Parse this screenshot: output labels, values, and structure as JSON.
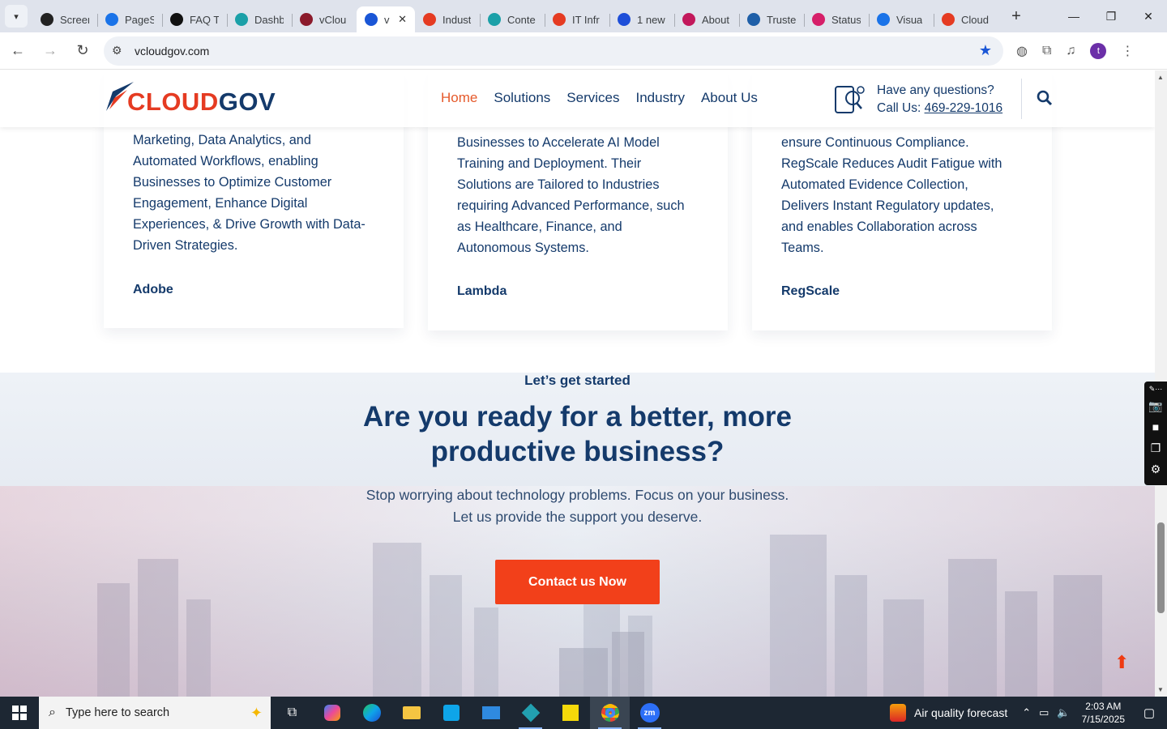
{
  "browser": {
    "tabs": [
      {
        "title": "Screen",
        "favicon_color": "#222222",
        "active": false
      },
      {
        "title": "PageS",
        "favicon_color": "#1a73e8",
        "active": false
      },
      {
        "title": "FAQ T",
        "favicon_color": "#111111",
        "active": false
      },
      {
        "title": "Dashb",
        "favicon_color": "#1ba0a8",
        "active": false
      },
      {
        "title": "vClou",
        "favicon_color": "#8b1a2b",
        "active": false
      },
      {
        "title": "vC",
        "favicon_color": "#1a56d6",
        "active": true
      },
      {
        "title": "Indust",
        "favicon_color": "#e53b22",
        "active": false
      },
      {
        "title": "Conte",
        "favicon_color": "#1ba0a8",
        "active": false
      },
      {
        "title": "IT Infr",
        "favicon_color": "#e53b22",
        "active": false
      },
      {
        "title": "1 new",
        "favicon_color": "#1d4ed8",
        "active": false
      },
      {
        "title": "About",
        "favicon_color": "#c2185b",
        "active": false
      },
      {
        "title": "Truste",
        "favicon_color": "#1f5fa8",
        "active": false
      },
      {
        "title": "Status",
        "favicon_color": "#d61f69",
        "active": false
      },
      {
        "title": "Visua",
        "favicon_color": "#1a73e8",
        "active": false
      },
      {
        "title": "Cloud",
        "favicon_color": "#e53b22",
        "active": false
      }
    ],
    "url": "vcloudgov.com"
  },
  "site": {
    "logo": {
      "part1": "CLOUD",
      "part2": "GOV"
    },
    "nav": [
      "Home",
      "Solutions",
      "Services",
      "Industry",
      "About Us"
    ],
    "contact": {
      "question": "Have any questions?",
      "call_label": "Call Us:",
      "phone": "469-229-1016"
    }
  },
  "cards": [
    {
      "lines": [
        "Marketing, Data Analytics, and",
        "Automated Workflows, enabling",
        "Businesses to Optimize Customer",
        "Engagement, Enhance Digital",
        "Experiences, & Drive Growth with Data-",
        "Driven Strategies."
      ],
      "name": "Adobe"
    },
    {
      "lines": [
        "Businesses to Accelerate AI Model",
        "Training and Deployment. Their",
        "Solutions are Tailored to Industries",
        "requiring Advanced Performance, such",
        "as Healthcare, Finance, and",
        "Autonomous Systems."
      ],
      "name": "Lambda"
    },
    {
      "lines": [
        "ensure Continuous Compliance.",
        "RegScale Reduces Audit Fatigue with",
        "Automated Evidence Collection,",
        "Delivers Instant Regulatory updates,",
        "and enables Collaboration across",
        "Teams."
      ],
      "name": "RegScale"
    }
  ],
  "cta": {
    "kicker": "Let’s get started",
    "title_line1": "Are you ready for a better, more",
    "title_line2": "productive business?",
    "sub_line1": "Stop worrying about technology problems. Focus on your business.",
    "sub_line2": "Let us provide the support you deserve.",
    "button": "Contact us Now"
  },
  "taskbar": {
    "search_placeholder": "Type here to search",
    "weather": "Air quality forecast",
    "time": "2:03 AM",
    "date": "7/15/2025"
  },
  "colors": {
    "brand_red": "#e53b22",
    "brand_navy": "#143a6b",
    "cta_orange": "#f2401a"
  }
}
